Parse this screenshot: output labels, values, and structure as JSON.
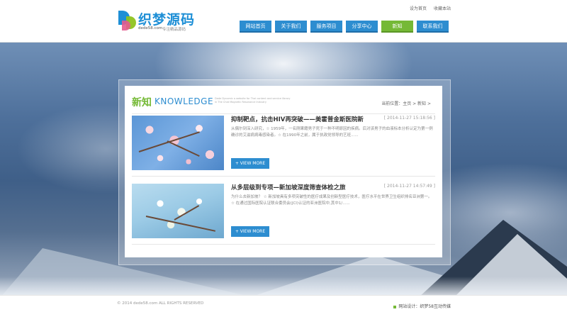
{
  "header": {
    "logo": {
      "title": "织梦源码",
      "domain": "dede58.com",
      "slogan": "专注精品源码"
    },
    "top_links": [
      "设为首页",
      "收藏本站"
    ],
    "nav": [
      {
        "label": "网站首页",
        "active": false
      },
      {
        "label": "关于我们",
        "active": false
      },
      {
        "label": "服务项目",
        "active": false
      },
      {
        "label": "分享中心",
        "active": false
      },
      {
        "label": "新知",
        "active": true
      },
      {
        "label": "联系我们",
        "active": false
      }
    ]
  },
  "section": {
    "title_cn": "新知",
    "title_en": "KNOWLEDGE",
    "description": "Dede Dynamic a website for Thai content and service library in The Chat Magnetic Resonance Industry",
    "breadcrumb": "当前位置：主页 > 新知 >"
  },
  "articles": [
    {
      "title": "抑制靶点，抗击HIV再突破——美霍普金斯医院新",
      "date": "[ 2014-11-27 15:18:56 ]",
      "summary": "从偶尔到深入研究，☆ 1959年，一名刚果籍男子死于一种不明原因的疾病。后对该男子的血液标本分析认定为第一例确诊的艾滋病病毒感染者。☆ 在1990年之前，属于执政党领导的艺班......",
      "button": "+ VIEW MORE"
    },
    {
      "title": "从多层级到专项—新加坡深度筛查体检之旅",
      "date": "[ 2014-11-27 14:57:49 ]",
      "summary": "为什么去新加坡？ ☆ 新加坡具有多项突破性的医疗成果及创新型医疗技术，医疗水平在世界卫生组织排名亚洲第一。☆ 在通过国际医院认证联合委员会(JCI)认证的亚洲医院中,其中1/......",
      "button": "+ VIEW MORE"
    }
  ],
  "footer": {
    "copyright": "© 2014 dede58.com ALL RIGHTS RESERVED",
    "designer": "网站设计：织梦58互动传媒"
  },
  "colors": {
    "primary_blue": "#2d8dd0",
    "accent_green": "#75b936",
    "text_dark": "#333333",
    "text_muted": "#888888"
  }
}
